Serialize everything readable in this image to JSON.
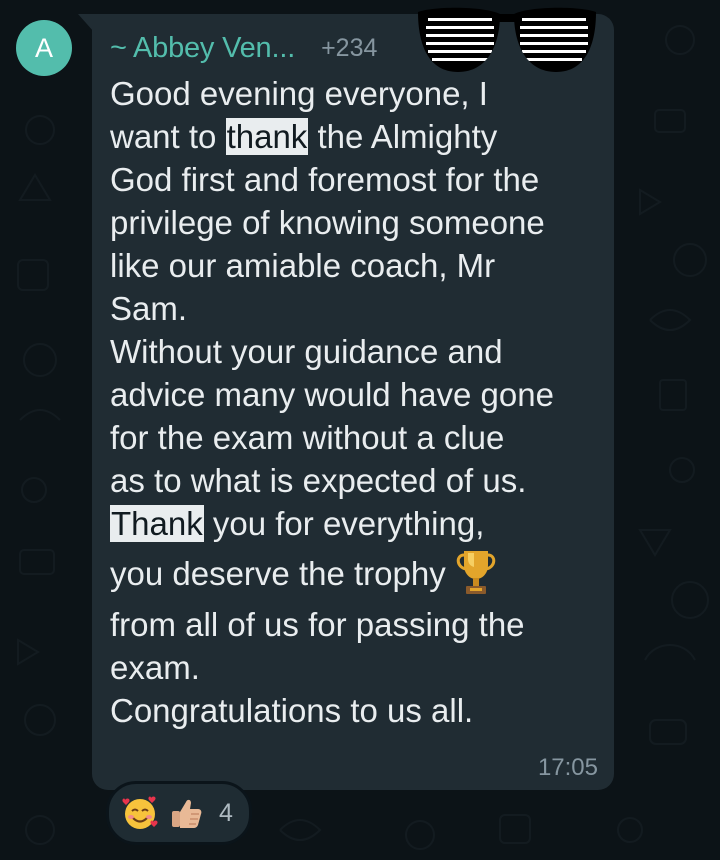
{
  "avatar": {
    "initial": "A",
    "color": "#53bdac"
  },
  "sender": {
    "name": "~ Abbey Ven...",
    "phone": "+234"
  },
  "message": {
    "lines": [
      "Good evening everyone, I",
      "want to ",
      "thank",
      " the Almighty",
      "God first and foremost for the",
      "privilege of knowing someone",
      "like our amiable coach, Mr",
      "Sam.",
      "Without your guidance and",
      "advice many would have gone",
      "for the exam without a clue",
      "as to what is expected of us.",
      "Thank",
      " you for everything,",
      "you deserve the trophy",
      "from all of us for passing the",
      "exam.",
      "Congratulations to us all."
    ],
    "timestamp": "17:05"
  },
  "reactions": {
    "emojis": [
      "smiling-face-with-hearts-icon",
      "thumbs-up-icon"
    ],
    "count": "4"
  },
  "colors": {
    "background": "#0c1317",
    "bubble": "#202c33",
    "text": "#e9edef",
    "accent": "#53bdac",
    "muted": "#8696a0",
    "highlight": "#e9edef"
  },
  "icons": {
    "trophy": "trophy-icon",
    "redaction": "sunglasses-icon"
  }
}
